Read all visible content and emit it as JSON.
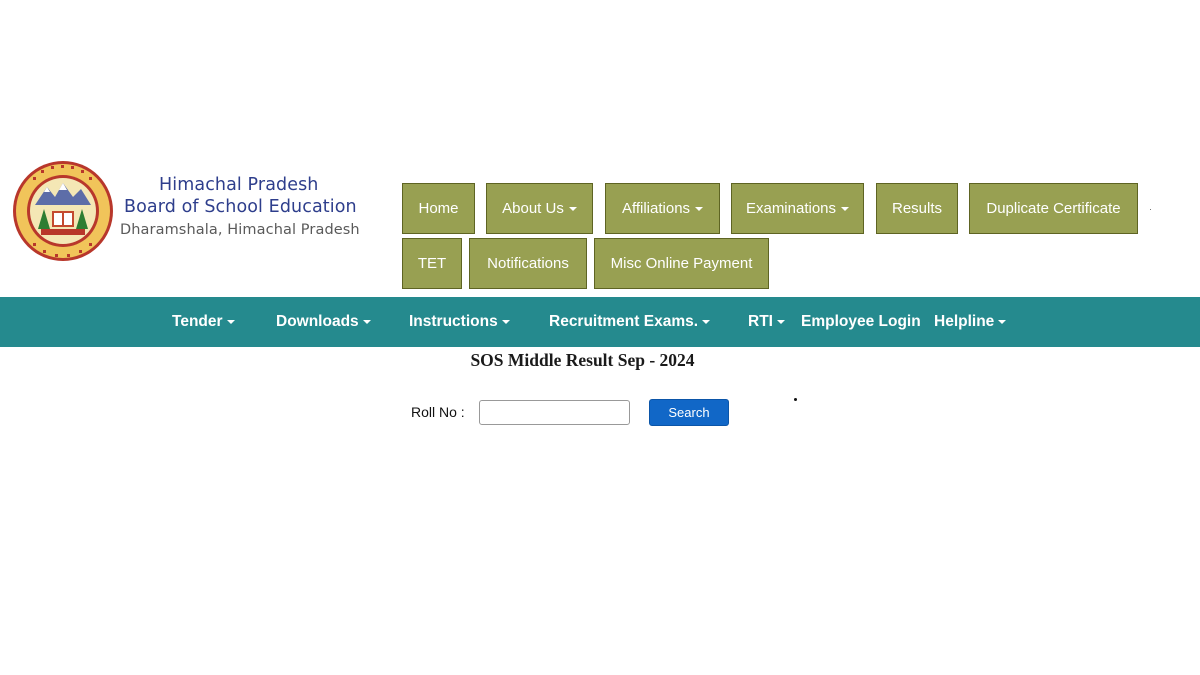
{
  "header": {
    "org_line1": "Himachal Pradesh",
    "org_line2": "Board of School Education",
    "org_line3": "Dharamshala, Himachal Pradesh"
  },
  "main_nav": {
    "items": [
      {
        "label": "Home",
        "has_dropdown": false
      },
      {
        "label": "About Us",
        "has_dropdown": true
      },
      {
        "label": "Affiliations",
        "has_dropdown": true
      },
      {
        "label": "Examinations",
        "has_dropdown": true
      },
      {
        "label": "Results",
        "has_dropdown": false
      },
      {
        "label": "Duplicate Certificate",
        "has_dropdown": false
      },
      {
        "label": "TET",
        "has_dropdown": false
      },
      {
        "label": "Notifications",
        "has_dropdown": false
      },
      {
        "label": "Misc Online Payment",
        "has_dropdown": false
      }
    ]
  },
  "secondary_nav": {
    "items": [
      {
        "label": "Tender",
        "has_dropdown": true
      },
      {
        "label": "Downloads",
        "has_dropdown": true
      },
      {
        "label": "Instructions",
        "has_dropdown": true
      },
      {
        "label": "Recruitment Exams.",
        "has_dropdown": true
      },
      {
        "label": "RTI",
        "has_dropdown": true
      },
      {
        "label": "Employee Login",
        "has_dropdown": false
      },
      {
        "label": "Helpline",
        "has_dropdown": true
      }
    ]
  },
  "page_title": "SOS Middle Result Sep - 2024",
  "form": {
    "roll_label": "Roll No :",
    "roll_value": "",
    "search_label": "Search"
  },
  "colors": {
    "nav_box": "#98a052",
    "teal_bar": "#258a8e",
    "search_button": "#1167c7",
    "org_title": "#2e3e8c"
  }
}
